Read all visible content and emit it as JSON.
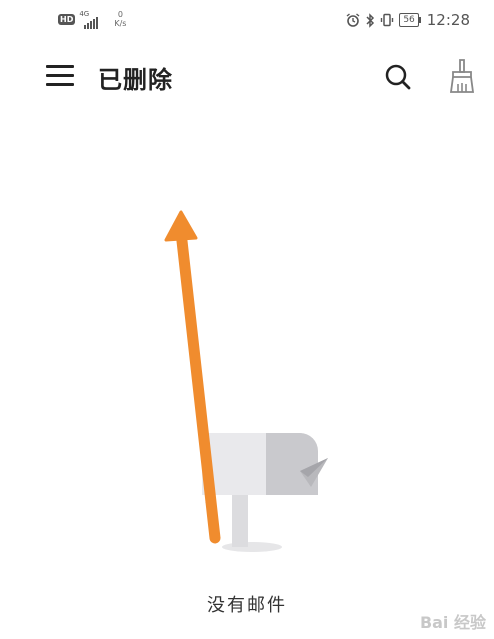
{
  "status_bar": {
    "hd_label": "HD",
    "network_gen": "4G",
    "speed_value": "0",
    "speed_unit": "K/s",
    "battery": "56",
    "time": "12:28"
  },
  "app_bar": {
    "title": "已删除",
    "menu_icon": "hamburger-menu-icon",
    "search_icon": "search-icon",
    "clean_icon": "broom-icon"
  },
  "empty_state": {
    "message": "没有邮件",
    "illustration": "mailbox-illustration"
  },
  "annotation": {
    "color": "#f08c2e"
  },
  "watermark": "Bai 经验"
}
